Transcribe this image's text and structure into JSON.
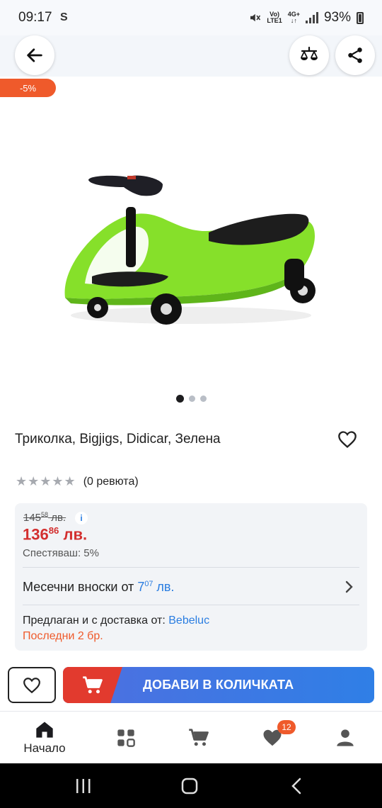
{
  "status_bar": {
    "time": "09:17",
    "s_icon": "S",
    "net_top": "Vo)",
    "net_bottom": "LTE1",
    "net4g": "4G+",
    "battery": "93%"
  },
  "product": {
    "discount": "-5%",
    "title": "Триколка, Bigjigs, Didicar, Зелена",
    "image_icon": "green-swing-car",
    "rating_count": "(0 ревюта)",
    "stars_icon": "star-rating-empty"
  },
  "price": {
    "old_int": "145",
    "old_dec": "58",
    "old_unit": " лв.",
    "info": "i",
    "new_int": "136",
    "new_dec": "86",
    "new_unit": " лв.",
    "savings": "Спестяваш: 5%",
    "installments_label": "Месечни вноски от ",
    "installments_int": "7",
    "installments_dec": "07",
    "installments_unit": " лв.",
    "seller_label": "Предлаган и с доставка от: ",
    "seller_name": "Bebeluc",
    "stock": "Последни 2 бр."
  },
  "actions": {
    "add_to_cart": "ДОБАВИ В КОЛИЧКАТА"
  },
  "bottom_nav": {
    "home": "Начало",
    "favorites_badge": "12"
  },
  "colors": {
    "accent_orange": "#ef5a2b",
    "price_red": "#d32f2f",
    "link_blue": "#2a7de1",
    "cart_red": "#e23a2e",
    "cart_blue": "#2f7fe6"
  }
}
